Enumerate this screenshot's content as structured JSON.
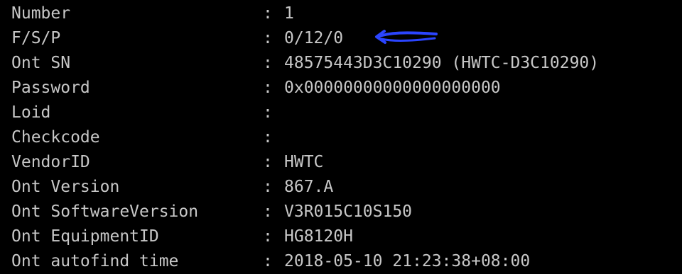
{
  "terminal": {
    "text_color": "#c7c7c7",
    "background_color": "#000000",
    "rows": [
      {
        "label": "Number",
        "separator": ":",
        "value": "1"
      },
      {
        "label": "F/S/P",
        "separator": ":",
        "value": "0/12/0"
      },
      {
        "label": "Ont SN",
        "separator": ":",
        "value": "48575443D3C10290 (HWTC-D3C10290)"
      },
      {
        "label": "Password",
        "separator": ":",
        "value": "0x00000000000000000000"
      },
      {
        "label": "Loid",
        "separator": ":",
        "value": ""
      },
      {
        "label": "Checkcode",
        "separator": ":",
        "value": ""
      },
      {
        "label": "VendorID",
        "separator": ":",
        "value": "HWTC"
      },
      {
        "label": "Ont Version",
        "separator": ":",
        "value": "867.A"
      },
      {
        "label": "Ont SoftwareVersion",
        "separator": ":",
        "value": "V3R015C10S150"
      },
      {
        "label": "Ont EquipmentID",
        "separator": ":",
        "value": "HG8120H"
      },
      {
        "label": "Ont autofind time",
        "separator": ":",
        "value": "2018-05-10 21:23:38+08:00"
      }
    ]
  },
  "annotation": {
    "icon": "hand-drawn-arrow-left-icon",
    "color": "#2b45ff"
  }
}
